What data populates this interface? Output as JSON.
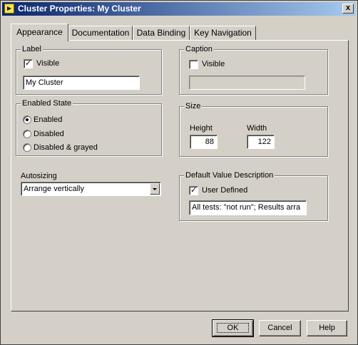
{
  "window": {
    "title": "Cluster Properties: My Cluster",
    "close_glyph": "x"
  },
  "tabs": [
    "Appearance",
    "Documentation",
    "Data Binding",
    "Key Navigation"
  ],
  "label_group": {
    "title": "Label",
    "visible_label": "Visible",
    "visible_checked": true,
    "value": "My Cluster"
  },
  "caption_group": {
    "title": "Caption",
    "visible_label": "Visible",
    "visible_checked": false,
    "value": ""
  },
  "enabled_group": {
    "title": "Enabled State",
    "options": [
      "Enabled",
      "Disabled",
      "Disabled & grayed"
    ],
    "selected": "Enabled"
  },
  "size_group": {
    "title": "Size",
    "height_label": "Height",
    "height_value": "88",
    "width_label": "Width",
    "width_value": "122"
  },
  "autosizing": {
    "label": "Autosizing",
    "value": "Arrange vertically"
  },
  "default_value": {
    "title": "Default Value Description",
    "user_defined_label": "User Defined",
    "user_defined_checked": true,
    "value": "All tests: \"not run\"; Results arra"
  },
  "buttons": {
    "ok": "OK",
    "cancel": "Cancel",
    "help": "Help"
  },
  "icons": {
    "title_icon": "labview-vi-icon",
    "close": "close-icon"
  }
}
